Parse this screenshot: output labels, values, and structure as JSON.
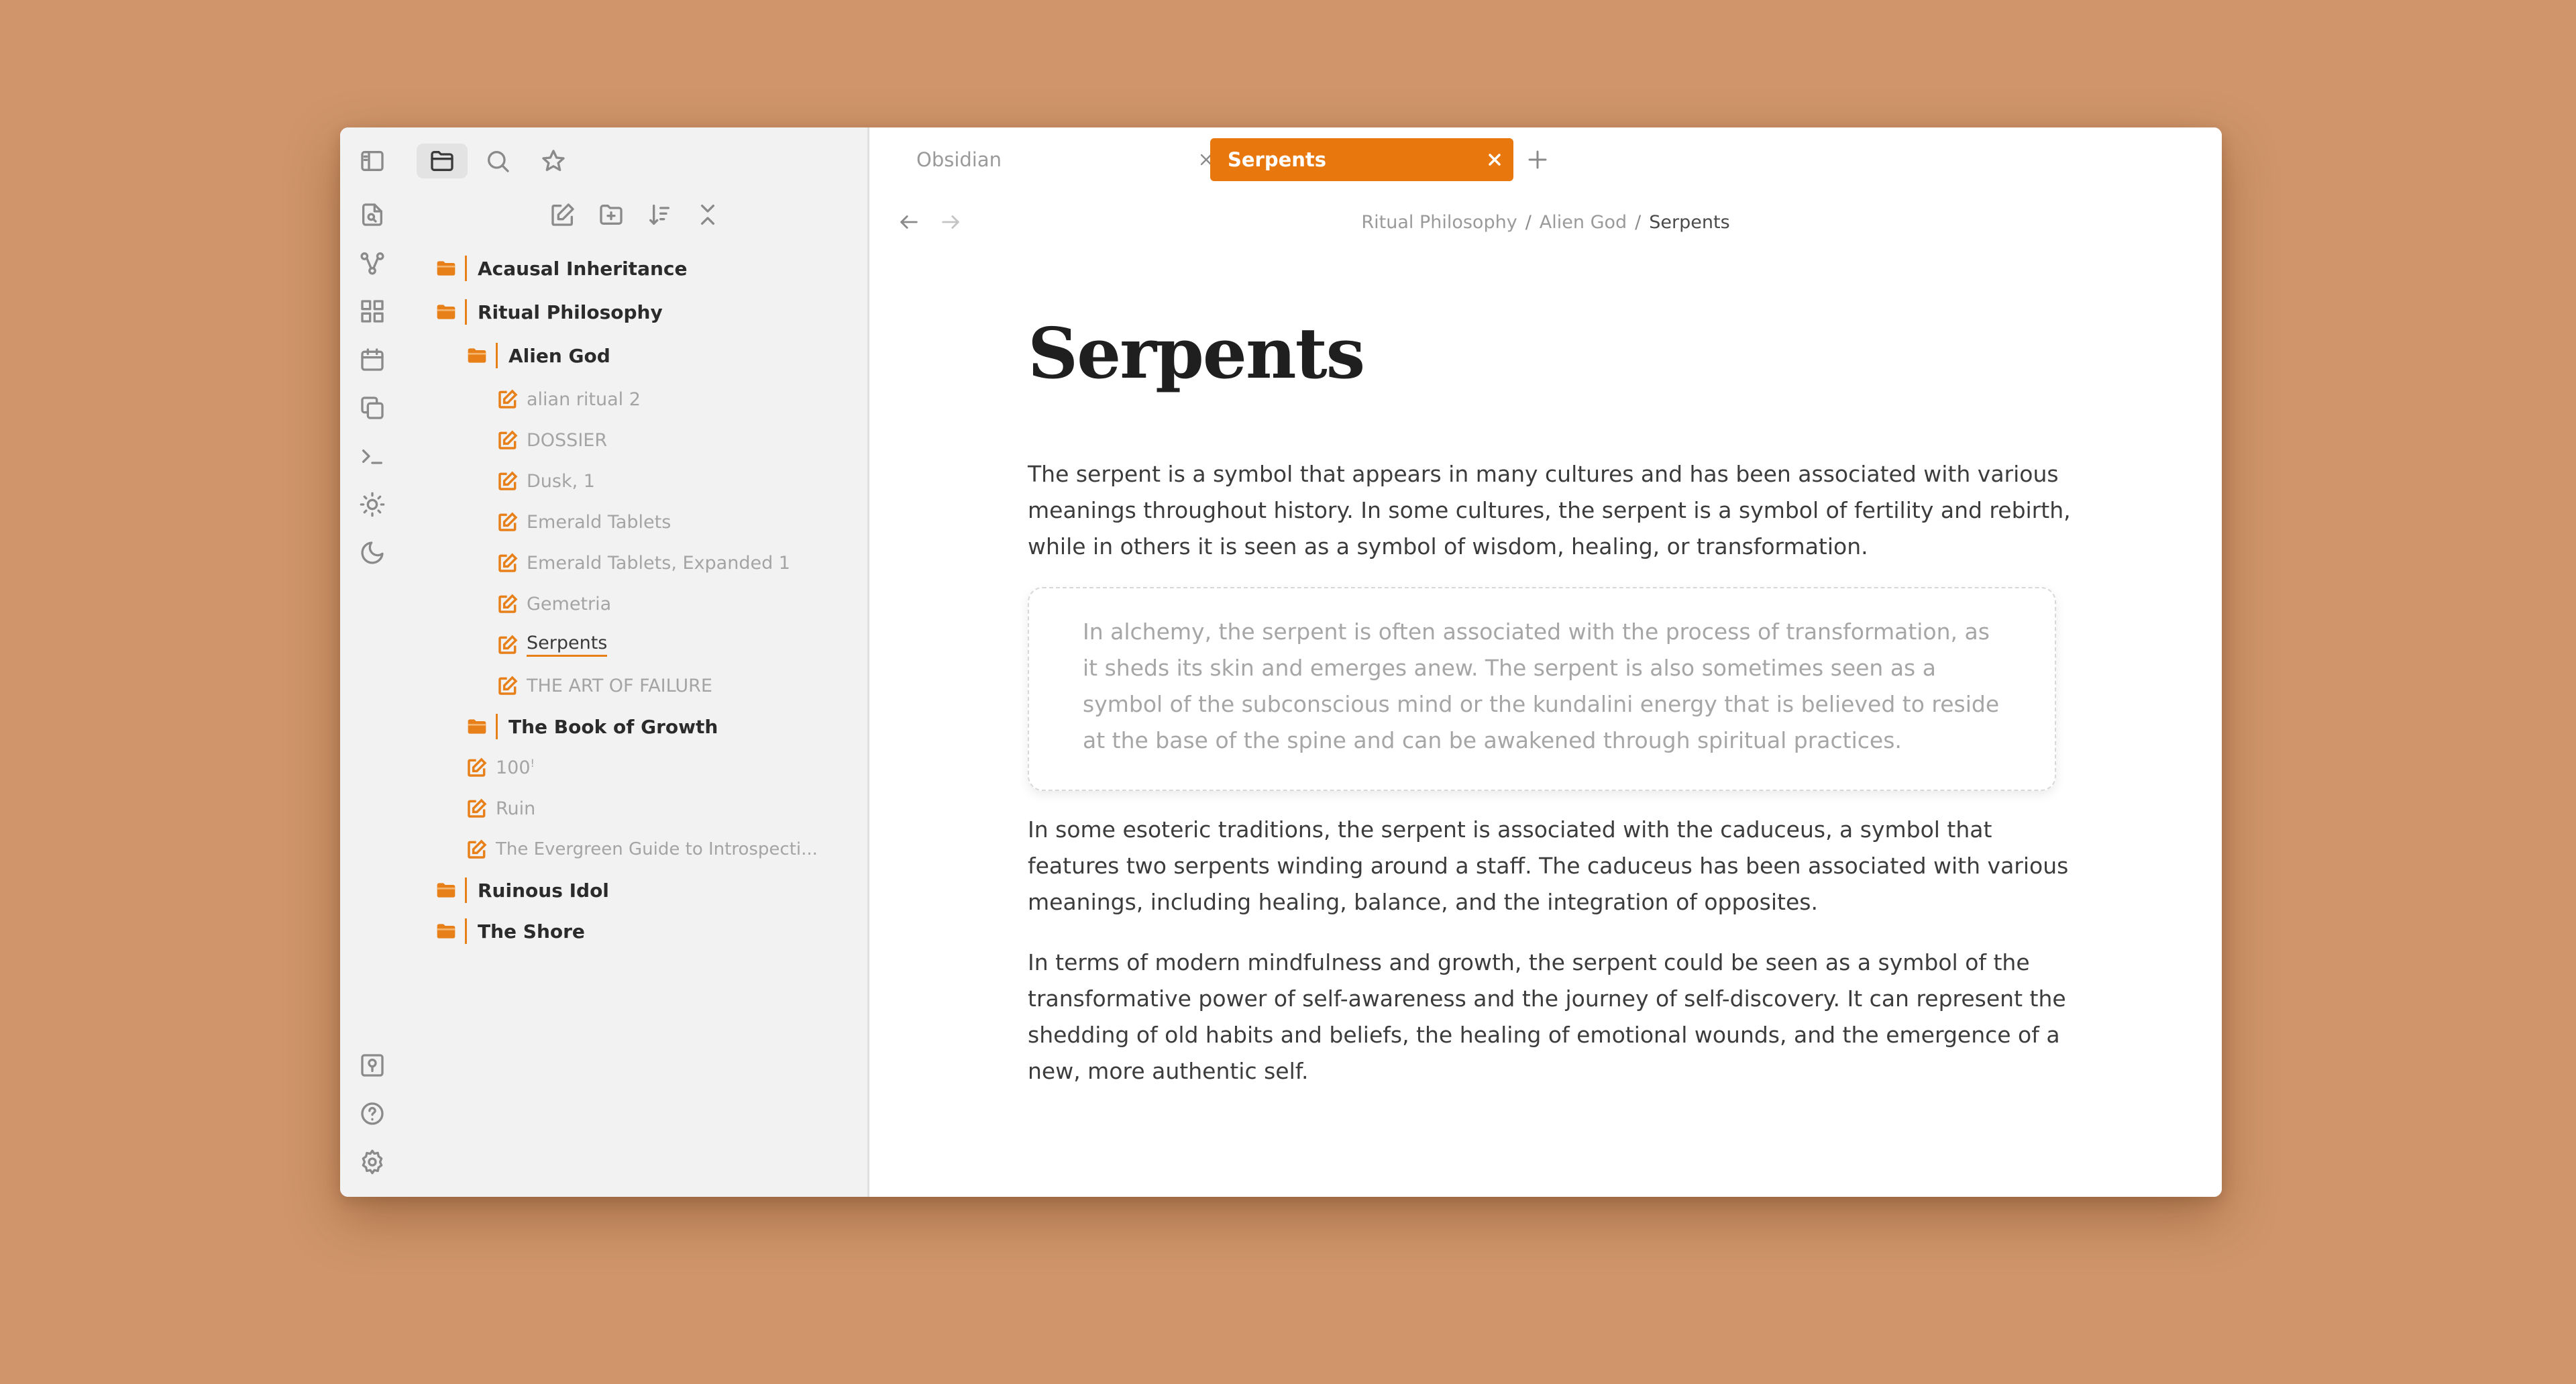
{
  "colors": {
    "background": "#D0956A",
    "accent": "#E8780E",
    "sidebar": "#F2F2F2"
  },
  "tabs": [
    {
      "label": "Obsidian",
      "active": false
    },
    {
      "label": "Serpents",
      "active": true
    }
  ],
  "breadcrumb": {
    "part1": "Ritual Philosophy",
    "sep": "/",
    "part2": "Alien God",
    "current": "Serpents"
  },
  "tree": {
    "acausal": "Acausal Inheritance",
    "ritual": "Ritual Philosophy",
    "alien_god": "Alien God",
    "files_alien": [
      "alian ritual 2",
      "DOSSIER",
      "Dusk, 1",
      "Emerald Tablets",
      "Emerald Tablets, Expanded 1",
      "Gemetria",
      "Serpents",
      "THE ART OF FAILURE"
    ],
    "book_growth": "The Book of Growth",
    "file_100": "100",
    "file_100_sup": "!",
    "file_ruin": "Ruin",
    "file_evergreen": "The Evergreen Guide to Introspecti...",
    "ruinous": "Ruinous Idol",
    "shore": "The Shore"
  },
  "document": {
    "title": "Serpents",
    "p1": "The serpent is a symbol that appears in many cultures and has been associated with various meanings throughout history. In some cultures, the serpent is a symbol of fertility and rebirth, while in others it is seen as a symbol of wisdom, healing, or transformation.",
    "callout": "In alchemy, the serpent is often associated with the process of transformation, as it sheds its skin and emerges anew. The serpent is also sometimes seen as a symbol of the subconscious mind or the kundalini energy that is believed to reside at the base of the spine and can be awakened through spiritual practices.",
    "p2": "In some esoteric traditions, the serpent is associated with the caduceus, a symbol that features two serpents winding around a staff. The caduceus has been associated with various meanings, including healing, balance, and the integration of opposites.",
    "p3": "In terms of modern mindfulness and growth, the serpent could be seen as a symbol of the transformative power of self-awareness and the journey of self-discovery. It can represent the shedding of old habits and beliefs, the healing of emotional wounds, and the emergence of a new, more authentic self."
  }
}
